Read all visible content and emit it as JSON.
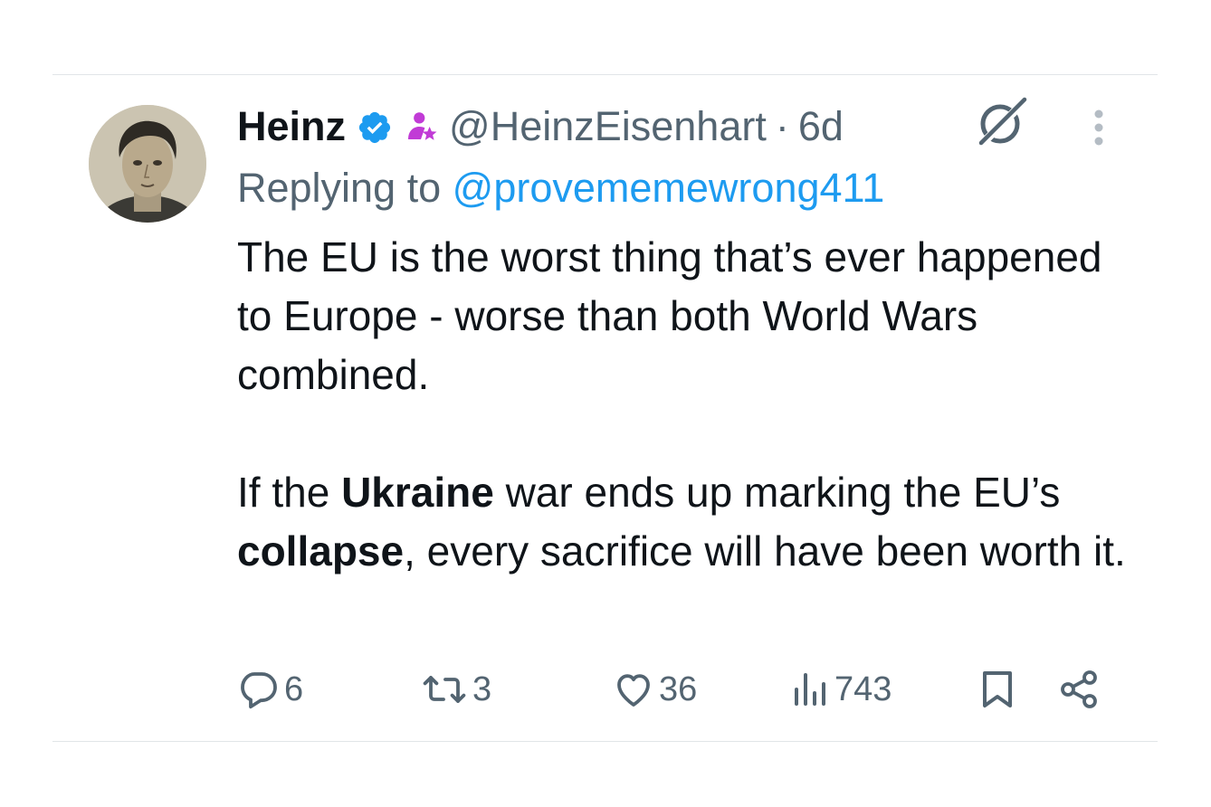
{
  "author": {
    "name": "Heinz",
    "handle": "@HeinzEisenhart",
    "separator": "·",
    "time": "6d"
  },
  "reply": {
    "prefix": "Replying to",
    "mention": "@provememewrong411"
  },
  "tweet": {
    "p1": "The EU is the worst thing that’s ever happened to Europe - worse than both World Wars combined.",
    "p2_part1": "If the ",
    "p2_bold1": "Ukraine",
    "p2_part2": " war ends up marking the EU’s ",
    "p2_bold2": "collapse",
    "p2_part3": ", every sacrifice will have been worth it."
  },
  "actions": {
    "replies": "6",
    "reposts": "3",
    "likes": "36",
    "views": "743"
  },
  "icons": {
    "verified": "verified-badge-icon",
    "affiliate": "affiliate-icon",
    "grok": "grok-icon",
    "more": "more-icon",
    "reply": "reply-icon",
    "repost": "repost-icon",
    "like": "heart-icon",
    "views": "views-icon",
    "bookmark": "bookmark-icon",
    "share": "share-icon"
  },
  "colors": {
    "text": "#0f1419",
    "secondary": "#536471",
    "link": "#1d9bf0",
    "verified": "#1d9bf0",
    "affiliate": "#c13bd6"
  }
}
